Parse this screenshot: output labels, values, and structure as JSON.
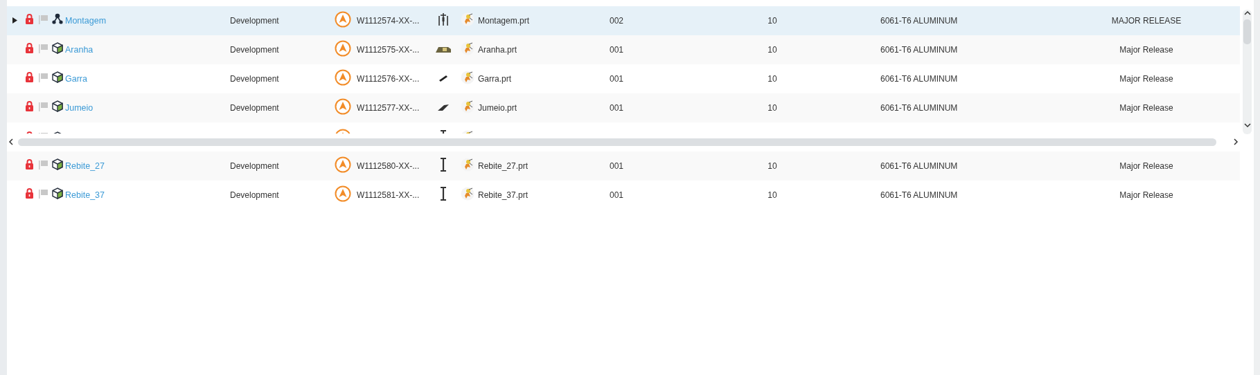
{
  "rows": [
    {
      "selected": true,
      "expandable": true,
      "locked": true,
      "kind": "assembly",
      "name": "Montagem",
      "state": "Development",
      "number": "W1112574-XX-...",
      "file": "Montagem.prt",
      "revision": "002",
      "quantity": "10",
      "material": "6061-T6 ALUMINUM",
      "release": "MAJOR RELEASE"
    },
    {
      "selected": false,
      "expandable": false,
      "locked": true,
      "kind": "part",
      "name": "Aranha",
      "state": "Development",
      "number": "W1112575-XX-...",
      "file": "Aranha.prt",
      "revision": "001",
      "quantity": "10",
      "material": "6061-T6 ALUMINUM",
      "release": "Major Release"
    },
    {
      "selected": false,
      "expandable": false,
      "locked": true,
      "kind": "part",
      "name": "Garra",
      "state": "Development",
      "number": "W1112576-XX-...",
      "file": "Garra.prt",
      "revision": "001",
      "quantity": "10",
      "material": "6061-T6 ALUMINUM",
      "release": "Major Release"
    },
    {
      "selected": false,
      "expandable": false,
      "locked": true,
      "kind": "part",
      "name": "Jumeio",
      "state": "Development",
      "number": "W1112577-XX-...",
      "file": "Jumeio.prt",
      "revision": "001",
      "quantity": "10",
      "material": "6061-T6 ALUMINUM",
      "release": "Major Release"
    },
    {
      "selected": false,
      "expandable": false,
      "locked": true,
      "kind": "obscured"
    },
    {
      "selected": false,
      "expandable": false,
      "locked": true,
      "kind": "part",
      "name": "Rebite_27",
      "state": "Development",
      "number": "W1112580-XX-...",
      "file": "Rebite_27.prt",
      "revision": "001",
      "quantity": "10",
      "material": "6061-T6 ALUMINUM",
      "release": "Major Release"
    },
    {
      "selected": false,
      "expandable": false,
      "locked": true,
      "kind": "part",
      "name": "Rebite_37",
      "state": "Development",
      "number": "W1112581-XX-...",
      "file": "Rebite_37.prt",
      "revision": "001",
      "quantity": "10",
      "material": "6061-T6 ALUMINUM",
      "release": "Major Release"
    }
  ]
}
